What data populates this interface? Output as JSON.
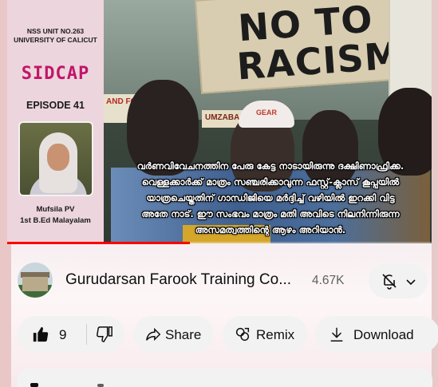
{
  "thumbnail": {
    "org_line1": "NSS UNIT NO.263",
    "org_line2": "UNIVERSITY OF CALICUT",
    "series_logo": "SIDCAP",
    "episode": "EPISODE 41",
    "presenter_name": "Mufsila PV",
    "presenter_class": "1st B.Ed Malayalam",
    "sign_no": "NO TO",
    "sign_racism": "RACISM!",
    "sign_small_a": "AND FOR",
    "sign_small_b": "UMZABALAZO",
    "cap_text": "GEAR",
    "caption_lines": [
      "വർണവിവേചനത്തിന പേരു കേട്ട നാടായിരുന്നു ദക്ഷിണാഫ്രിക്ക.",
      "വെള്ളക്കാർക്ക് മാത്രം സഞ്ചരിക്കാവുന്ന ഫസ്റ്റ്-ക്ലാസ് കൂപ്പയിൽ",
      "യാത്രചെയ്തതിന് ഗാന്ധിജിയെ മർദ്ദിച്ച് വഴിയിൽ ഇറക്കി വിട്ട",
      "അതേ നാട്. ഈ സംഭവം മാത്രം മതി അവിടെ നിലനിന്നിരുന്ന",
      "അസമത്വത്തിന്റെ ആഴം അറിയാൻ."
    ],
    "progress_fraction": 0.43,
    "colors": {
      "progress": "#ff0000",
      "logo": "#c0166a"
    }
  },
  "channel": {
    "name": "Gurudarsan Farook Training Co...",
    "subscribers": "4.67K",
    "avatar_icon": "college-building-avatar",
    "notification_icon": "bell-off-icon",
    "dropdown_icon": "chevron-down-icon"
  },
  "actions": {
    "like_count": "9",
    "like_icon": "thumbs-up-icon",
    "dislike_icon": "thumbs-down-icon",
    "share_label": "Share",
    "share_icon": "share-arrow-icon",
    "remix_label": "Remix",
    "remix_icon": "remix-icon",
    "download_label": "Download",
    "download_icon": "download-icon"
  },
  "comments": {
    "icon": "comments-icon"
  }
}
